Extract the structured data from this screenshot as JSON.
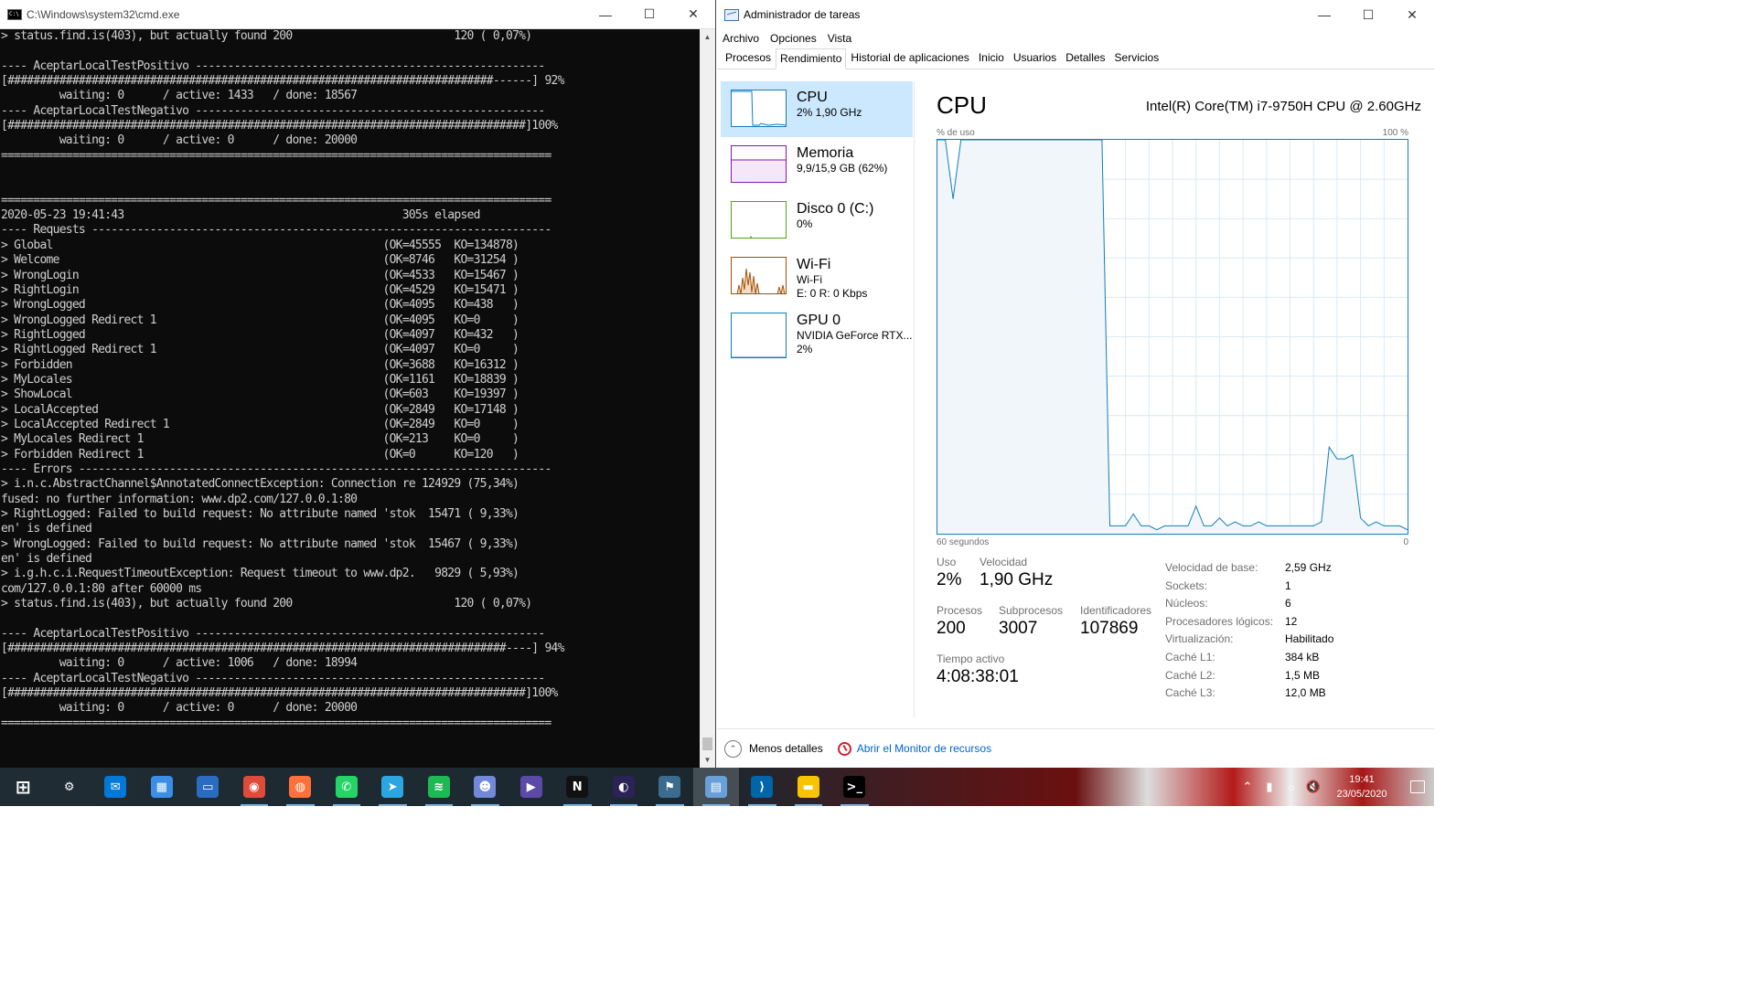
{
  "cmd": {
    "title": "C:\\Windows\\system32\\cmd.exe",
    "lines": [
      "> status.find.is(403), but actually found 200                         120 ( 0,07%)",
      "",
      "---- AceptarLocalTestPositivo ------------------------------------------------------",
      "[###########################################################################------] 92%",
      "         waiting: 0      / active: 1433   / done: 18567",
      "---- AceptarLocalTestNegativo ------------------------------------------------------",
      "[################################################################################]100%",
      "         waiting: 0      / active: 0      / done: 20000",
      "=====================================================================================",
      "",
      "",
      "=====================================================================================",
      "2020-05-23 19:41:43                                           305s elapsed",
      "---- Requests -----------------------------------------------------------------------",
      "> Global                                                   (OK=45555  KO=134878)",
      "> Welcome                                                  (OK=8746   KO=31254 )",
      "> WrongLogin                                               (OK=4533   KO=15467 )",
      "> RightLogin                                               (OK=4529   KO=15471 )",
      "> WrongLogged                                              (OK=4095   KO=438   )",
      "> WrongLogged Redirect 1                                   (OK=4095   KO=0     )",
      "> RightLogged                                              (OK=4097   KO=432   )",
      "> RightLogged Redirect 1                                   (OK=4097   KO=0     )",
      "> Forbidden                                                (OK=3688   KO=16312 )",
      "> MyLocales                                                (OK=1161   KO=18839 )",
      "> ShowLocal                                                (OK=603    KO=19397 )",
      "> LocalAccepted                                            (OK=2849   KO=17148 )",
      "> LocalAccepted Redirect 1                                 (OK=2849   KO=0     )",
      "> MyLocales Redirect 1                                     (OK=213    KO=0     )",
      "> Forbidden Redirect 1                                     (OK=0      KO=120   )",
      "---- Errors -------------------------------------------------------------------------",
      "> i.n.c.AbstractChannel$AnnotatedConnectException: Connection re 124929 (75,34%)",
      "fused: no further information: www.dp2.com/127.0.0.1:80",
      "> RightLogged: Failed to build request: No attribute named 'stok  15471 ( 9,33%)",
      "en' is defined",
      "> WrongLogged: Failed to build request: No attribute named 'stok  15467 ( 9,33%)",
      "en' is defined",
      "> i.g.h.c.i.RequestTimeoutException: Request timeout to www.dp2.   9829 ( 5,93%)",
      "com/127.0.0.1:80 after 60000 ms",
      "> status.find.is(403), but actually found 200                         120 ( 0,07%)",
      "",
      "---- AceptarLocalTestPositivo ------------------------------------------------------",
      "[#############################################################################----] 94%",
      "         waiting: 0      / active: 1006   / done: 18994",
      "---- AceptarLocalTestNegativo ------------------------------------------------------",
      "[################################################################################]100%",
      "         waiting: 0      / active: 0      / done: 20000",
      "====================================================================================="
    ]
  },
  "taskmanager": {
    "title": "Administrador de tareas",
    "menu": [
      "Archivo",
      "Opciones",
      "Vista"
    ],
    "tabs": [
      "Procesos",
      "Rendimiento",
      "Historial de aplicaciones",
      "Inicio",
      "Usuarios",
      "Detalles",
      "Servicios"
    ],
    "active_tab": "Rendimiento",
    "resources": [
      {
        "title": "CPU",
        "sub1": "2% 1,90 GHz",
        "sub2": "",
        "color": "#117dbb"
      },
      {
        "title": "Memoria",
        "sub1": "9,9/15,9 GB (62%)",
        "sub2": "",
        "color": "#8b12ae"
      },
      {
        "title": "Disco 0 (C:)",
        "sub1": "0%",
        "sub2": "",
        "color": "#4da60c"
      },
      {
        "title": "Wi-Fi",
        "sub1": "Wi-Fi",
        "sub2": "E: 0 R: 0 Kbps",
        "color": "#a74f01"
      },
      {
        "title": "GPU 0",
        "sub1": "NVIDIA GeForce RTX...",
        "sub2": "2%",
        "color": "#117dbb"
      }
    ],
    "cpu": {
      "heading": "CPU",
      "model": "Intel(R) Core(TM) i7-9750H CPU @ 2.60GHz",
      "graph_top_left": "% de uso",
      "graph_top_right": "100 %",
      "graph_bottom_left": "60 segundos",
      "graph_bottom_right": "0",
      "stats": {
        "uso_label": "Uso",
        "uso": "2%",
        "velocidad_label": "Velocidad",
        "velocidad": "1,90 GHz",
        "procesos_label": "Procesos",
        "procesos": "200",
        "subprocesos_label": "Subprocesos",
        "subprocesos": "3007",
        "identificadores_label": "Identificadores",
        "identificadores": "107869",
        "tiempo_label": "Tiempo activo",
        "tiempo": "4:08:38:01"
      },
      "specs": [
        {
          "k": "Velocidad de base:",
          "v": "2,59 GHz"
        },
        {
          "k": "Sockets:",
          "v": "1"
        },
        {
          "k": "Núcleos:",
          "v": "6"
        },
        {
          "k": "Procesadores lógicos:",
          "v": "12"
        },
        {
          "k": "Virtualización:",
          "v": "Habilitado"
        },
        {
          "k": "Caché L1:",
          "v": "384 kB"
        },
        {
          "k": "Caché L2:",
          "v": "1,5 MB"
        },
        {
          "k": "Caché L3:",
          "v": "12,0 MB"
        }
      ]
    },
    "footer": {
      "less": "Menos detalles",
      "monitor": "Abrir el Monitor de recursos"
    }
  },
  "taskbar": {
    "apps": [
      {
        "name": "start-button",
        "glyph": "⊞",
        "bg": "transparent"
      },
      {
        "name": "settings-icon",
        "glyph": "⚙",
        "bg": "transparent"
      },
      {
        "name": "mail-icon",
        "glyph": "✉",
        "bg": "#0078d7"
      },
      {
        "name": "explorer-board-icon",
        "glyph": "▦",
        "bg": "#3a8ee6"
      },
      {
        "name": "remote-desktop-icon",
        "glyph": "▭",
        "bg": "#2a6cc0"
      },
      {
        "name": "chrome-icon",
        "glyph": "◉",
        "bg": "#dd4b39"
      },
      {
        "name": "firefox-icon",
        "glyph": "◍",
        "bg": "#ff7139"
      },
      {
        "name": "whatsapp-icon",
        "glyph": "✆",
        "bg": "#25d366"
      },
      {
        "name": "telegram-icon",
        "glyph": "➤",
        "bg": "#2ca5e0"
      },
      {
        "name": "spotify-icon",
        "glyph": "≋",
        "bg": "#1db954"
      },
      {
        "name": "discord-icon",
        "glyph": "☻",
        "bg": "#7289da"
      },
      {
        "name": "media-player-icon",
        "glyph": "▶",
        "bg": "#5b4aa8"
      },
      {
        "name": "netflix-icon",
        "glyph": "N",
        "bg": "#111"
      },
      {
        "name": "eclipse-icon",
        "glyph": "◐",
        "bg": "#2c2255"
      },
      {
        "name": "mysql-workbench-icon",
        "glyph": "⚑",
        "bg": "#3b6b8f"
      },
      {
        "name": "task-manager-icon",
        "glyph": "▤",
        "bg": "#6aa0d8"
      },
      {
        "name": "vscode-icon",
        "glyph": "⟩",
        "bg": "#0065a9"
      },
      {
        "name": "file-explorer-icon",
        "glyph": "▬",
        "bg": "#f8c300"
      },
      {
        "name": "cmd-icon",
        "glyph": ">_",
        "bg": "#000"
      }
    ],
    "clock_time": "19:41",
    "clock_date": "23/05/2020"
  },
  "chart_data": [
    {
      "type": "line",
      "title": "CPU",
      "xlabel": "60 segundos",
      "ylabel": "% de uso",
      "ylim": [
        0,
        100
      ],
      "x": [
        60,
        59,
        58,
        57,
        56,
        55,
        54,
        53,
        52,
        51,
        50,
        49,
        48,
        47,
        46,
        45,
        44,
        43,
        42,
        41,
        40,
        39,
        38,
        37,
        36,
        35,
        34,
        33,
        32,
        31,
        30,
        29,
        28,
        27,
        26,
        25,
        24,
        23,
        22,
        21,
        20,
        19,
        18,
        17,
        16,
        15,
        14,
        13,
        12,
        11,
        10,
        9,
        8,
        7,
        6,
        5,
        4,
        3,
        2,
        1,
        0
      ],
      "series": [
        {
          "name": "",
          "values": [
            100,
            100,
            85,
            100,
            100,
            100,
            100,
            100,
            100,
            100,
            100,
            100,
            100,
            100,
            100,
            100,
            100,
            100,
            100,
            100,
            100,
            100,
            2,
            2,
            2,
            5,
            2,
            2,
            1,
            2,
            2,
            2,
            2,
            7,
            2,
            2,
            4,
            2,
            3,
            2,
            2,
            3,
            2,
            2,
            2,
            2,
            2,
            2,
            2,
            3,
            22,
            19,
            19,
            20,
            4,
            2,
            3,
            2,
            2,
            2,
            1
          ]
        }
      ]
    }
  ]
}
